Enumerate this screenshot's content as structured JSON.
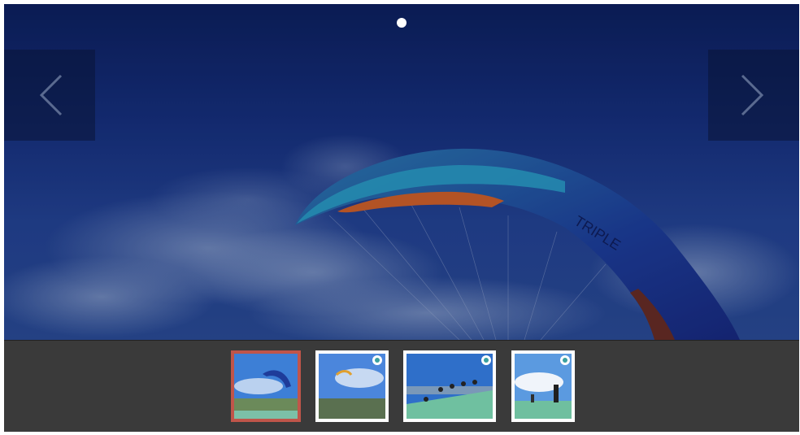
{
  "slider": {
    "active_index": 0,
    "dots": [
      {
        "state": "active"
      }
    ],
    "prev_icon": "chevron-left-icon",
    "next_icon": "chevron-right-icon",
    "main_image": "paraglider-wing-sky"
  },
  "thumbnails": [
    {
      "image": "paraglider-wing-sky",
      "active": true
    },
    {
      "image": "paraglider-over-landscape",
      "active": false
    },
    {
      "image": "paraglider-launch-sequence",
      "active": false
    },
    {
      "image": "people-on-launch-ramp",
      "active": false
    }
  ],
  "colors": {
    "active_thumb_border": "#c0554a",
    "thumb_border": "#ffffff",
    "thumb_bar": "#3a3a3a",
    "sky": "#152e78"
  }
}
